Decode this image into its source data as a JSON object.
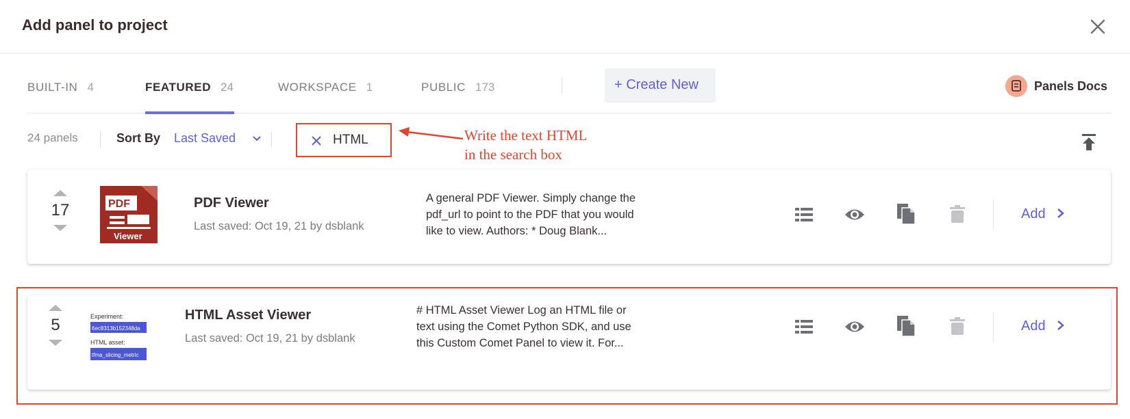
{
  "dialog": {
    "title": "Add panel to project",
    "close_icon": "close-icon"
  },
  "tabs": [
    {
      "label": "BUILT-IN",
      "count": "4"
    },
    {
      "label": "FEATURED",
      "count": "24"
    },
    {
      "label": "WORKSPACE",
      "count": "1"
    },
    {
      "label": "PUBLIC",
      "count": "173"
    }
  ],
  "create_new": {
    "label": "+ Create New"
  },
  "docs": {
    "label": "Panels Docs",
    "icon": "docs-icon"
  },
  "toolbar": {
    "count": "24 panels",
    "sort_label": "Sort By",
    "sort_value": "Last Saved",
    "search_value": "HTML"
  },
  "annotation": {
    "line1": "Write the text HTML",
    "line2": "in the search box"
  },
  "panels": [
    {
      "votes": "17",
      "name": "PDF Viewer",
      "saved": "Last saved: Oct 19, 21 by dsblank",
      "desc_lines": [
        "A general PDF Viewer. Simply change the",
        "pdf_url to point to the PDF that you would",
        "like to view. Authors: * Doug Blank..."
      ],
      "thumb": {
        "top": "PDF",
        "bottom": "Viewer"
      },
      "add_label": "Add"
    },
    {
      "votes": "5",
      "name": "HTML Asset Viewer",
      "saved": "Last saved: Oct 19, 21 by dsblank",
      "desc_lines": [
        "# HTML Asset Viewer Log an HTML file or",
        "text using the Comet Python SDK, and use",
        "this Custom Comet Panel to view it. For..."
      ],
      "thumb": {
        "exp_label": "Experiment:",
        "exp_value": "6ec8313b152348da",
        "asset_label": "HTML asset:",
        "asset_value": "tfma_slicing_metric"
      },
      "add_label": "Add"
    }
  ],
  "colors": {
    "accent": "#5d5fe0",
    "annotation": "#e3442c"
  }
}
